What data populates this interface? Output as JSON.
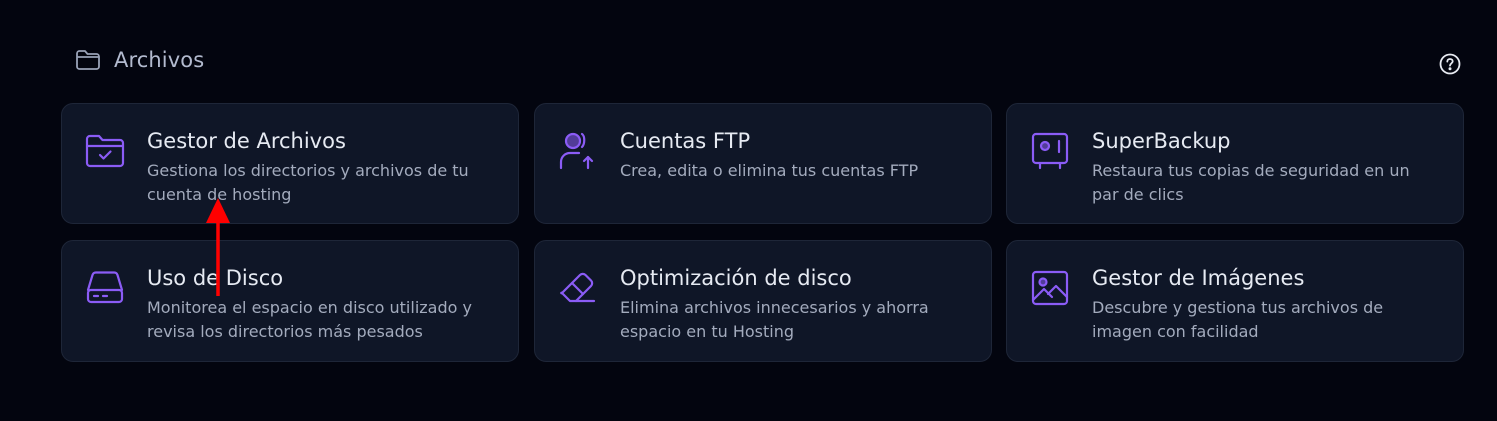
{
  "section": {
    "title": "Archivos",
    "icon": "folder-icon",
    "help_icon": "help-circle-icon"
  },
  "colors": {
    "background": "#03050f",
    "card_background": "#0f1627",
    "card_border": "#1e2638",
    "accent": "#8b5cf6",
    "title_text": "#e6eaf2",
    "description_text": "#a3abbd",
    "annotation_arrow": "#ff0000"
  },
  "cards": [
    {
      "title": "Gestor de Archivos",
      "description": "Gestiona los directorios y archivos de tu cuenta de hosting",
      "icon": "folder-check-icon"
    },
    {
      "title": "Cuentas FTP",
      "description": "Crea, edita o elimina tus cuentas FTP",
      "icon": "user-upload-icon"
    },
    {
      "title": "SuperBackup",
      "description": "Restaura tus copias de seguridad en un par de clics",
      "icon": "safe-icon"
    },
    {
      "title": "Uso de Disco",
      "description": "Monitorea el espacio en disco utilizado y revisa los directorios más pesados",
      "icon": "hard-drive-icon"
    },
    {
      "title": "Optimización de disco",
      "description": "Elimina archivos innecesarios y ahorra espacio en tu Hosting",
      "icon": "eraser-icon"
    },
    {
      "title": "Gestor de Imágenes",
      "description": "Descubre y gestiona tus archivos de imagen con facilidad",
      "icon": "image-icon"
    }
  ]
}
